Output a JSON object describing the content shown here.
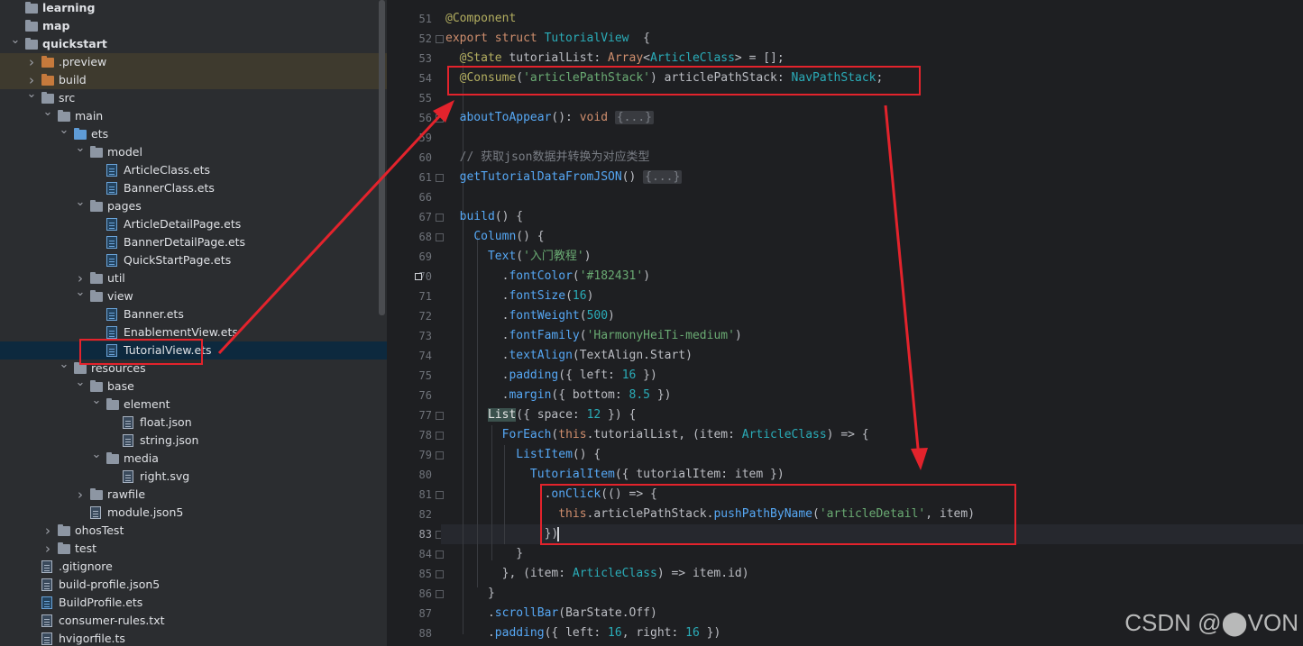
{
  "tree": [
    {
      "label": "learning",
      "depth": 0,
      "arrow": "",
      "icon": "folder",
      "bold": true
    },
    {
      "label": "map",
      "depth": 0,
      "arrow": "",
      "icon": "folder",
      "bold": true
    },
    {
      "label": "quickstart",
      "depth": 0,
      "arrow": "down",
      "icon": "folder",
      "bold": true
    },
    {
      "label": ".preview",
      "depth": 1,
      "arrow": "right",
      "icon": "folder-orange",
      "hl": true
    },
    {
      "label": "build",
      "depth": 1,
      "arrow": "right",
      "icon": "folder-orange",
      "hl": true
    },
    {
      "label": "src",
      "depth": 1,
      "arrow": "down",
      "icon": "folder"
    },
    {
      "label": "main",
      "depth": 2,
      "arrow": "down",
      "icon": "folder"
    },
    {
      "label": "ets",
      "depth": 3,
      "arrow": "down",
      "icon": "folder-blue"
    },
    {
      "label": "model",
      "depth": 4,
      "arrow": "down",
      "icon": "folder"
    },
    {
      "label": "ArticleClass.ets",
      "depth": 5,
      "arrow": "",
      "icon": "ets"
    },
    {
      "label": "BannerClass.ets",
      "depth": 5,
      "arrow": "",
      "icon": "ets"
    },
    {
      "label": "pages",
      "depth": 4,
      "arrow": "down",
      "icon": "folder"
    },
    {
      "label": "ArticleDetailPage.ets",
      "depth": 5,
      "arrow": "",
      "icon": "ets"
    },
    {
      "label": "BannerDetailPage.ets",
      "depth": 5,
      "arrow": "",
      "icon": "ets"
    },
    {
      "label": "QuickStartPage.ets",
      "depth": 5,
      "arrow": "",
      "icon": "ets"
    },
    {
      "label": "util",
      "depth": 4,
      "arrow": "right",
      "icon": "folder"
    },
    {
      "label": "view",
      "depth": 4,
      "arrow": "down",
      "icon": "folder"
    },
    {
      "label": "Banner.ets",
      "depth": 5,
      "arrow": "",
      "icon": "ets"
    },
    {
      "label": "EnablementView.ets",
      "depth": 5,
      "arrow": "",
      "icon": "ets"
    },
    {
      "label": "TutorialView.ets",
      "depth": 5,
      "arrow": "",
      "icon": "ets",
      "sel": true
    },
    {
      "label": "resources",
      "depth": 3,
      "arrow": "down",
      "icon": "folder"
    },
    {
      "label": "base",
      "depth": 4,
      "arrow": "down",
      "icon": "folder"
    },
    {
      "label": "element",
      "depth": 5,
      "arrow": "down",
      "icon": "folder"
    },
    {
      "label": "float.json",
      "depth": 6,
      "arrow": "",
      "icon": "file"
    },
    {
      "label": "string.json",
      "depth": 6,
      "arrow": "",
      "icon": "file"
    },
    {
      "label": "media",
      "depth": 5,
      "arrow": "down",
      "icon": "folder"
    },
    {
      "label": "right.svg",
      "depth": 6,
      "arrow": "",
      "icon": "file"
    },
    {
      "label": "rawfile",
      "depth": 4,
      "arrow": "right",
      "icon": "folder"
    },
    {
      "label": "module.json5",
      "depth": 4,
      "arrow": "",
      "icon": "file"
    },
    {
      "label": "ohosTest",
      "depth": 2,
      "arrow": "right",
      "icon": "folder"
    },
    {
      "label": "test",
      "depth": 2,
      "arrow": "right",
      "icon": "folder"
    },
    {
      "label": ".gitignore",
      "depth": 1,
      "arrow": "",
      "icon": "file"
    },
    {
      "label": "build-profile.json5",
      "depth": 1,
      "arrow": "",
      "icon": "file"
    },
    {
      "label": "BuildProfile.ets",
      "depth": 1,
      "arrow": "",
      "icon": "ets"
    },
    {
      "label": "consumer-rules.txt",
      "depth": 1,
      "arrow": "",
      "icon": "file"
    },
    {
      "label": "hvigorfile.ts",
      "depth": 1,
      "arrow": "",
      "icon": "file"
    }
  ],
  "editor": {
    "line_numbers": [
      "51",
      "52",
      "53",
      "54",
      "55",
      "56",
      "59",
      "60",
      "61",
      "66",
      "67",
      "68",
      "69",
      "70",
      "71",
      "72",
      "73",
      "74",
      "75",
      "76",
      "77",
      "78",
      "79",
      "80",
      "81",
      "82",
      "83",
      "84",
      "85",
      "86",
      "87",
      "88"
    ],
    "current_line": "83",
    "lines": [
      [
        [
          "an",
          "@Component"
        ]
      ],
      [
        [
          "kw",
          "export struct "
        ],
        [
          "ty",
          "TutorialView"
        ],
        [
          "",
          "  {"
        ]
      ],
      [
        [
          "",
          "  "
        ],
        [
          "an",
          "@State "
        ],
        [
          "",
          "tutorialList: "
        ],
        [
          "kw",
          "Array"
        ],
        [
          "",
          "<"
        ],
        [
          "ty",
          "ArticleClass"
        ],
        [
          "",
          "> = [];"
        ]
      ],
      [
        [
          "",
          "  "
        ],
        [
          "an",
          "@Consume"
        ],
        [
          "",
          "("
        ],
        [
          "st",
          "'articlePathStack'"
        ],
        [
          "",
          ") articlePathStack: "
        ],
        [
          "ty",
          "NavPathStack"
        ],
        [
          "",
          ";"
        ]
      ],
      [],
      [
        [
          "",
          "  "
        ],
        [
          "fn",
          "aboutToAppear"
        ],
        [
          "",
          "(): "
        ],
        [
          "kw",
          "void "
        ],
        [
          "fo",
          "{...}"
        ]
      ],
      [],
      [
        [
          "cm",
          "  // 获取json数据并转换为对应类型"
        ]
      ],
      [
        [
          "",
          "  "
        ],
        [
          "fn",
          "getTutorialDataFromJSON"
        ],
        [
          "",
          "() "
        ],
        [
          "fo",
          "{...}"
        ]
      ],
      [],
      [
        [
          "",
          "  "
        ],
        [
          "fn",
          "build"
        ],
        [
          "",
          "() {"
        ]
      ],
      [
        [
          "",
          "    "
        ],
        [
          "fn",
          "Column"
        ],
        [
          "",
          "() {"
        ]
      ],
      [
        [
          "",
          "      "
        ],
        [
          "fn",
          "Text"
        ],
        [
          "",
          "("
        ],
        [
          "st",
          "'入门教程'"
        ],
        [
          "",
          ")"
        ]
      ],
      [
        [
          "",
          "        ."
        ],
        [
          "fn",
          "fontColor"
        ],
        [
          "",
          "("
        ],
        [
          "st",
          "'#182431'"
        ],
        [
          "",
          ")"
        ]
      ],
      [
        [
          "",
          "        ."
        ],
        [
          "fn",
          "fontSize"
        ],
        [
          "",
          "("
        ],
        [
          "nu",
          "16"
        ],
        [
          "",
          ")"
        ]
      ],
      [
        [
          "",
          "        ."
        ],
        [
          "fn",
          "fontWeight"
        ],
        [
          "",
          "("
        ],
        [
          "nu",
          "500"
        ],
        [
          "",
          ")"
        ]
      ],
      [
        [
          "",
          "        ."
        ],
        [
          "fn",
          "fontFamily"
        ],
        [
          "",
          "("
        ],
        [
          "st",
          "'HarmonyHeiTi-medium'"
        ],
        [
          "",
          ")"
        ]
      ],
      [
        [
          "",
          "        ."
        ],
        [
          "fn",
          "textAlign"
        ],
        [
          "",
          "(TextAlign.Start)"
        ]
      ],
      [
        [
          "",
          "        ."
        ],
        [
          "fn",
          "padding"
        ],
        [
          "",
          "({ left: "
        ],
        [
          "nu",
          "16"
        ],
        [
          "",
          " })"
        ]
      ],
      [
        [
          "",
          "        ."
        ],
        [
          "fn",
          "margin"
        ],
        [
          "",
          "({ bottom: "
        ],
        [
          "nu",
          "8.5"
        ],
        [
          "",
          " })"
        ]
      ],
      [
        [
          "",
          "      "
        ],
        [
          "bm",
          "List"
        ],
        [
          "",
          "({ space: "
        ],
        [
          "nu",
          "12"
        ],
        [
          "",
          " }) {"
        ]
      ],
      [
        [
          "",
          "        "
        ],
        [
          "fn",
          "ForEach"
        ],
        [
          "",
          "("
        ],
        [
          "kw",
          "this"
        ],
        [
          "",
          ".tutorialList, (item: "
        ],
        [
          "ty",
          "ArticleClass"
        ],
        [
          "",
          ") => {"
        ]
      ],
      [
        [
          "",
          "          "
        ],
        [
          "fn",
          "ListItem"
        ],
        [
          "",
          "() {"
        ]
      ],
      [
        [
          "",
          "            "
        ],
        [
          "fn",
          "TutorialItem"
        ],
        [
          "",
          "({ tutorialItem: item })"
        ]
      ],
      [
        [
          "",
          "              ."
        ],
        [
          "fn",
          "onClick"
        ],
        [
          "",
          "(() => {"
        ]
      ],
      [
        [
          "",
          "                "
        ],
        [
          "kw",
          "this"
        ],
        [
          "",
          ".articlePathStack."
        ],
        [
          "fn",
          "pushPathByName"
        ],
        [
          "",
          "("
        ],
        [
          "st",
          "'articleDetail'"
        ],
        [
          "",
          ", item)"
        ]
      ],
      [
        [
          "",
          "              })"
        ]
      ],
      [
        [
          "",
          "          }"
        ]
      ],
      [
        [
          "",
          "        }, (item: "
        ],
        [
          "ty",
          "ArticleClass"
        ],
        [
          "",
          ") => item.id)"
        ]
      ],
      [
        [
          "",
          "      }"
        ]
      ],
      [
        [
          "",
          "      ."
        ],
        [
          "fn",
          "scrollBar"
        ],
        [
          "",
          "(BarState.Off)"
        ]
      ],
      [
        [
          "",
          "      ."
        ],
        [
          "fn",
          "padding"
        ],
        [
          "",
          "({ left: "
        ],
        [
          "nu",
          "16"
        ],
        [
          "",
          ", right: "
        ],
        [
          "nu",
          "16"
        ],
        [
          "",
          " })"
        ]
      ]
    ]
  },
  "watermark": "CSDN @⬤VON",
  "colors": {
    "annotation_red": "#e3232c",
    "editor_bg": "#1e1f22",
    "tree_bg": "#2b2d30"
  }
}
